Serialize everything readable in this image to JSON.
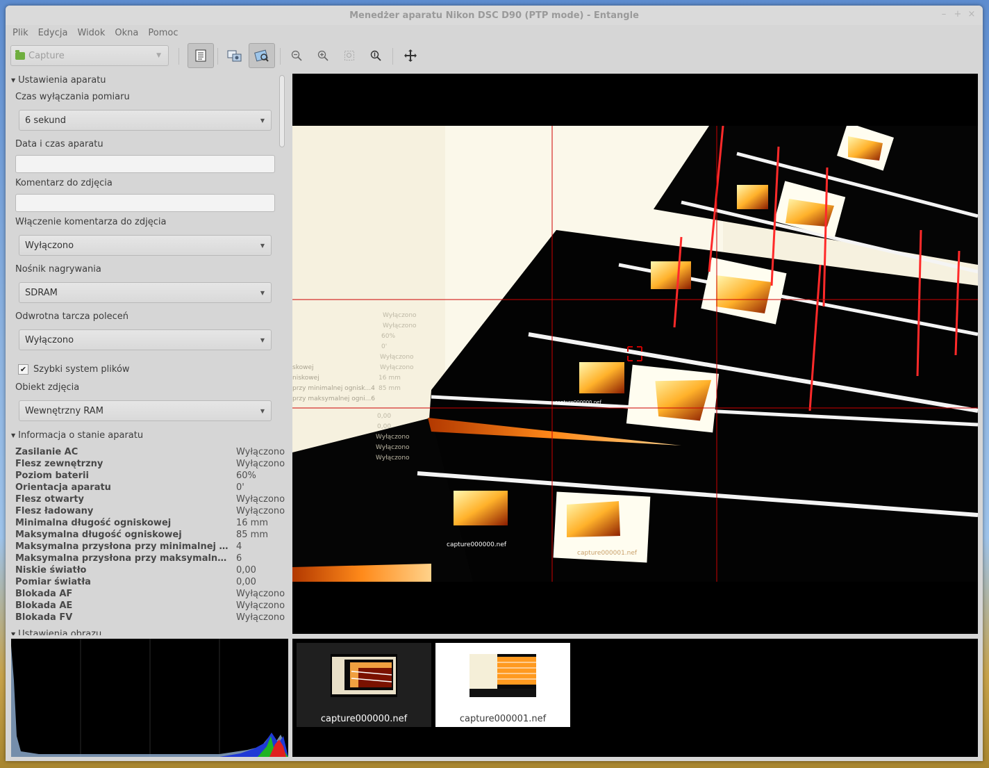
{
  "window": {
    "title": "Menedżer aparatu Nikon DSC D90 (PTP mode) - Entangle"
  },
  "menubar": [
    "Plik",
    "Edycja",
    "Widok",
    "Okna",
    "Pomoc"
  ],
  "toolbar": {
    "session_combo": "Capture",
    "buttons": [
      "settings-panel-icon",
      "capture-icon",
      "preview-icon",
      "zoom-out-icon",
      "zoom-in-icon",
      "zoom-fit-icon",
      "zoom-normal-icon",
      "fullscreen-icon"
    ]
  },
  "settings": {
    "camera_section": "Ustawienia aparatu",
    "meter_off_label": "Czas wyłączania pomiaru",
    "meter_off_value": "6 sekund",
    "datetime_label": "Data i czas aparatu",
    "datetime_value": "",
    "comment_label": "Komentarz do zdjęcia",
    "comment_value": "",
    "comment_enable_label": "Włączenie komentarza do zdjęcia",
    "comment_enable_value": "Wyłączono",
    "recording_media_label": "Nośnik nagrywania",
    "recording_media_value": "SDRAM",
    "reverse_dial_label": "Odwrotna tarcza poleceń",
    "reverse_dial_value": "Wyłączono",
    "fast_fs_label": "Szybki system plików",
    "fast_fs_checked": true,
    "capture_target_label": "Obiekt zdjęcia",
    "capture_target_value": "Wewnętrzny RAM",
    "status_section": "Informacja o stanie aparatu",
    "image_section": "Ustawienia obrazu"
  },
  "status": [
    {
      "k": "Zasilanie AC",
      "v": "Wyłączono"
    },
    {
      "k": "Flesz zewnętrzny",
      "v": "Wyłączono"
    },
    {
      "k": "Poziom baterii",
      "v": "60%"
    },
    {
      "k": "Orientacja aparatu",
      "v": "0'"
    },
    {
      "k": "Flesz otwarty",
      "v": "Wyłączono"
    },
    {
      "k": "Flesz ładowany",
      "v": "Wyłączono"
    },
    {
      "k": "Minimalna długość ogniskowej",
      "v": "16 mm"
    },
    {
      "k": "Maksymalna długość ogniskowej",
      "v": "85 mm"
    },
    {
      "k": "Maksymalna przysłona przy minimalnej ognisk...",
      "v": "4"
    },
    {
      "k": "Maksymalna przysłona przy maksymalnej ogni...",
      "v": "6"
    },
    {
      "k": "Niskie światło",
      "v": "0,00"
    },
    {
      "k": "Pomiar światła",
      "v": "0,00"
    },
    {
      "k": "Blokada AF",
      "v": "Wyłączono"
    },
    {
      "k": "Blokada AE",
      "v": "Wyłączono"
    },
    {
      "k": "Blokada FV",
      "v": "Wyłączono"
    }
  ],
  "filmstrip": [
    {
      "name": "capture000000.nef",
      "selected": false
    },
    {
      "name": "capture000001.nef",
      "selected": true
    }
  ],
  "preview": {
    "overlay_labels": [
      "capture000000.nef",
      "capture000001.nef"
    ]
  }
}
